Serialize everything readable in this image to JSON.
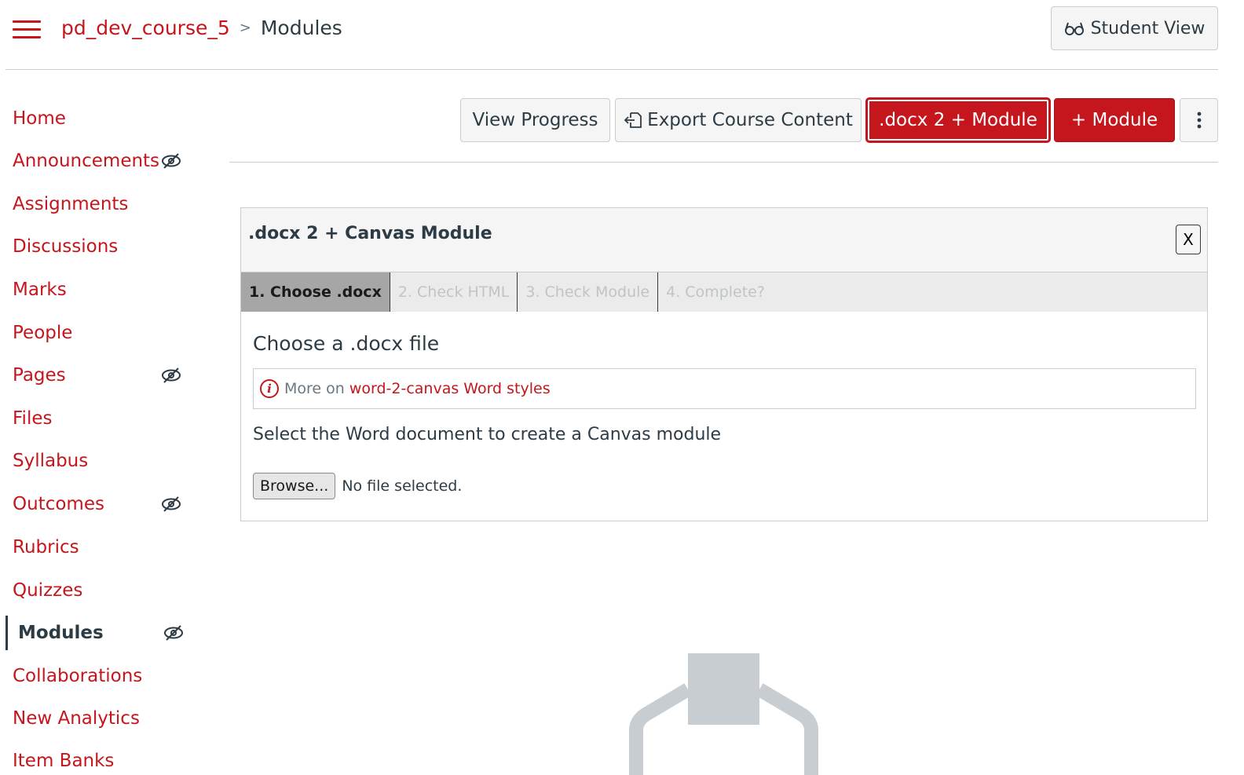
{
  "header": {
    "menu_icon": "hamburger-icon",
    "course_name": "pd_dev_course_5",
    "separator": ">",
    "current_page": "Modules",
    "student_view_label": "Student View",
    "student_view_icon": "glasses-icon"
  },
  "sidebar": {
    "items": [
      {
        "label": "Home",
        "hidden_icon": false,
        "active": false
      },
      {
        "label": "Announcements",
        "hidden_icon": true,
        "active": false
      },
      {
        "label": "Assignments",
        "hidden_icon": false,
        "active": false
      },
      {
        "label": "Discussions",
        "hidden_icon": false,
        "active": false
      },
      {
        "label": "Marks",
        "hidden_icon": false,
        "active": false
      },
      {
        "label": "People",
        "hidden_icon": false,
        "active": false
      },
      {
        "label": "Pages",
        "hidden_icon": true,
        "active": false
      },
      {
        "label": "Files",
        "hidden_icon": false,
        "active": false
      },
      {
        "label": "Syllabus",
        "hidden_icon": false,
        "active": false
      },
      {
        "label": "Outcomes",
        "hidden_icon": true,
        "active": false
      },
      {
        "label": "Rubrics",
        "hidden_icon": false,
        "active": false
      },
      {
        "label": "Quizzes",
        "hidden_icon": false,
        "active": false
      },
      {
        "label": "Modules",
        "hidden_icon": true,
        "active": true
      },
      {
        "label": "Collaborations",
        "hidden_icon": false,
        "active": false
      },
      {
        "label": "New Analytics",
        "hidden_icon": false,
        "active": false
      },
      {
        "label": "Item Banks",
        "hidden_icon": false,
        "active": false
      }
    ]
  },
  "toolbar": {
    "view_progress_label": "View Progress",
    "export_label": "Export Course Content",
    "export_icon": "export-icon",
    "docx_module_label": ".docx 2 + Module",
    "add_module_label": "+ Module",
    "more_icon": "kebab-menu-icon"
  },
  "panel": {
    "title": ".docx 2 + Canvas Module",
    "close_label": "X",
    "tabs": [
      {
        "label": "1. Choose .docx",
        "active": true
      },
      {
        "label": "2. Check HTML",
        "active": false
      },
      {
        "label": "3. Check Module",
        "active": false
      },
      {
        "label": "4. Complete?",
        "active": false
      }
    ],
    "heading": "Choose a .docx file",
    "info_prefix": "More on",
    "info_link": "word-2-canvas Word styles",
    "instruction": "Select the Word document to create a Canvas module",
    "browse_label": "Browse...",
    "file_status": "No file selected."
  },
  "colors": {
    "brand_red": "#c4161c",
    "text_dark": "#2d3b45",
    "border_gray": "#c7cdd1",
    "panel_bg": "#f5f5f5",
    "illustration_gray": "#c7cdd1"
  }
}
